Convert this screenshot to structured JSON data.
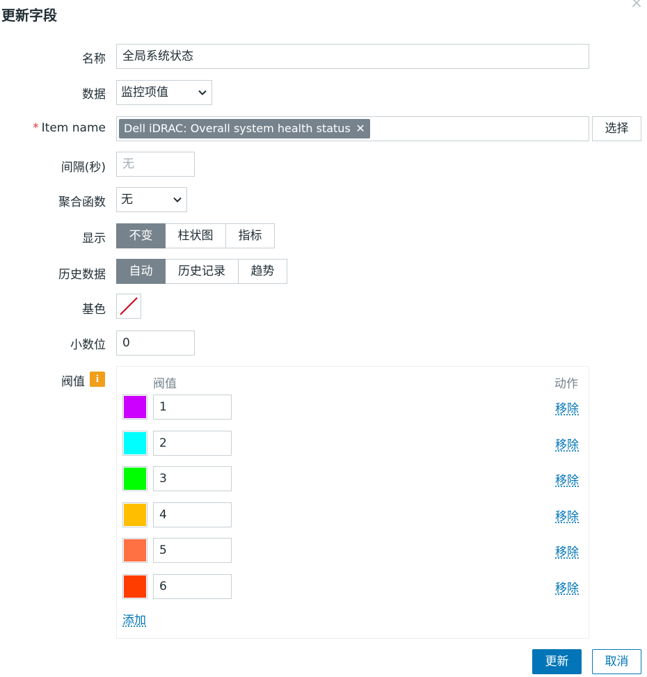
{
  "dialog": {
    "title": "更新字段",
    "close_glyph": "×"
  },
  "form": {
    "name": {
      "label": "名称",
      "value": "全局系统状态"
    },
    "data": {
      "label": "数据",
      "value": "监控项值"
    },
    "item_name": {
      "required_mark": "*",
      "label": "Item name",
      "tag": "Dell iDRAC: Overall system health status",
      "tag_remove_glyph": "✕",
      "select_button": "选择"
    },
    "interval": {
      "label": "间隔(秒)",
      "placeholder": "无"
    },
    "aggregate": {
      "label": "聚合函数",
      "value": "无"
    },
    "display": {
      "label": "显示",
      "options": [
        "不变",
        "柱状图",
        "指标"
      ],
      "selected": "不变"
    },
    "history": {
      "label": "历史数据",
      "options": [
        "自动",
        "历史记录",
        "趋势"
      ],
      "selected": "自动"
    },
    "base_color": {
      "label": "基色",
      "icon": "no-color-icon"
    },
    "decimals": {
      "label": "小数位",
      "value": "0"
    },
    "thresholds": {
      "label": "阀值",
      "info_icon": "i",
      "col_threshold": "阀值",
      "col_action": "动作",
      "rows": [
        {
          "color": "#CC00FF",
          "value": "1",
          "action": "移除"
        },
        {
          "color": "#00FFFF",
          "value": "2",
          "action": "移除"
        },
        {
          "color": "#00FF00",
          "value": "3",
          "action": "移除"
        },
        {
          "color": "#FFBF00",
          "value": "4",
          "action": "移除"
        },
        {
          "color": "#FF7043",
          "value": "5",
          "action": "移除"
        },
        {
          "color": "#FF3D00",
          "value": "6",
          "action": "移除"
        }
      ],
      "add_label": "添加"
    }
  },
  "footer": {
    "update_button": "更新",
    "cancel_button": "取消"
  },
  "colors": {
    "accent": "#0275B8",
    "tag_bg": "#76838D",
    "info_badge": "#F19F1B",
    "required": "#E33734"
  }
}
